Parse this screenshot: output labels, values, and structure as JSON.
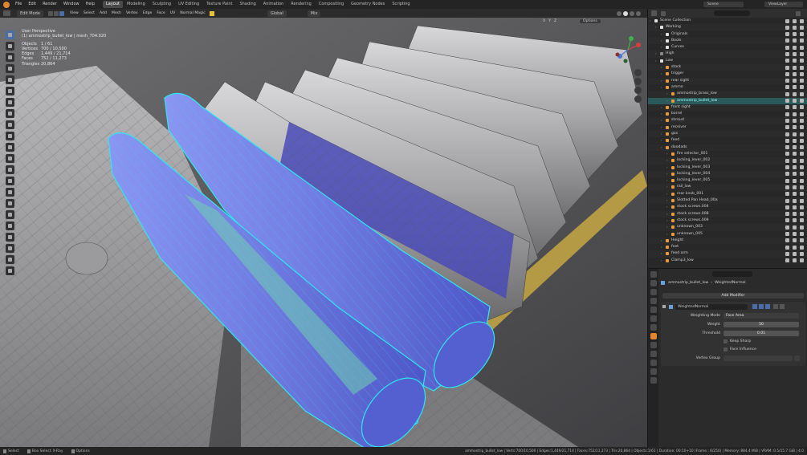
{
  "menu": {
    "items": [
      "File",
      "Edit",
      "Render",
      "Window",
      "Help"
    ],
    "workspaces": [
      "Layout",
      "Modeling",
      "Sculpting",
      "UV Editing",
      "Texture Paint",
      "Shading",
      "Animation",
      "Rendering",
      "Compositing",
      "Geometry Nodes",
      "Scripting"
    ],
    "active_workspace": "Layout",
    "scene": "Scene",
    "view_layer": "ViewLayer"
  },
  "viewport_header": {
    "mode": "Edit Mode",
    "menus": [
      "View",
      "Select",
      "Add",
      "Mesh",
      "Vertex",
      "Edge",
      "Face",
      "UV"
    ],
    "normal_magic": "Normal Magic",
    "orientation": "Global",
    "pivot": "Mix",
    "options": "Options",
    "axes": [
      "X",
      "Y",
      "Z"
    ]
  },
  "viewport_info": {
    "perspective": "User Perspective",
    "object_line": "(1) ammostrip_bullet_low | mesh_704.020",
    "stats": [
      {
        "label": "Objects",
        "value": "1 / 61"
      },
      {
        "label": "Vertices",
        "value": "700 / 10,500"
      },
      {
        "label": "Edges",
        "value": "1,449 / 21,714"
      },
      {
        "label": "Faces",
        "value": "752 / 11,273"
      },
      {
        "label": "Triangles",
        "value": "20,864"
      }
    ]
  },
  "outliner": {
    "title": "Scene Collection",
    "rows": [
      {
        "name": "Scene Collection",
        "indent": 0,
        "color": "#e0e0e0"
      },
      {
        "name": "Working",
        "indent": 1,
        "color": "#e0e0e0"
      },
      {
        "name": "Originals",
        "indent": 2,
        "color": "#e0e0e0"
      },
      {
        "name": "Bools",
        "indent": 2,
        "color": "#e0e0e0"
      },
      {
        "name": "Curves",
        "indent": 2,
        "color": "#e0e0e0"
      },
      {
        "name": "High",
        "indent": 1,
        "color": "#8a8a8a"
      },
      {
        "name": "Low",
        "indent": 1,
        "color": "#e0e0e0"
      },
      {
        "name": "stock",
        "indent": 2,
        "color": "#e89a3c"
      },
      {
        "name": "trigger",
        "indent": 2,
        "color": "#e89a3c"
      },
      {
        "name": "rear sight",
        "indent": 2,
        "color": "#e89a3c"
      },
      {
        "name": "ammo",
        "indent": 2,
        "color": "#e89a3c"
      },
      {
        "name": "ammostrip_brass_low",
        "indent": 3,
        "color": "#e89a3c"
      },
      {
        "name": "ammostrip_bullet_low",
        "indent": 3,
        "color": "#e89a3c",
        "selected": true
      },
      {
        "name": "front sight",
        "indent": 2,
        "color": "#e89a3c"
      },
      {
        "name": "barrel",
        "indent": 2,
        "color": "#e89a3c"
      },
      {
        "name": "shroud",
        "indent": 2,
        "color": "#e89a3c"
      },
      {
        "name": "receiver",
        "indent": 2,
        "color": "#e89a3c"
      },
      {
        "name": "gas",
        "indent": 2,
        "color": "#e89a3c"
      },
      {
        "name": "feed",
        "indent": 2,
        "color": "#e89a3c"
      },
      {
        "name": "doodads",
        "indent": 2,
        "color": "#e89a3c"
      },
      {
        "name": "fire selector_001",
        "indent": 3,
        "color": "#e89a3c"
      },
      {
        "name": "locking_lever_002",
        "indent": 3,
        "color": "#e89a3c"
      },
      {
        "name": "locking_lever_003",
        "indent": 3,
        "color": "#e89a3c"
      },
      {
        "name": "locking_lever_004",
        "indent": 3,
        "color": "#e89a3c"
      },
      {
        "name": "locking_lever_005",
        "indent": 3,
        "color": "#e89a3c"
      },
      {
        "name": "rail_low",
        "indent": 3,
        "color": "#e89a3c"
      },
      {
        "name": "rear knob_001",
        "indent": 3,
        "color": "#e89a3c"
      },
      {
        "name": "Slotted Pan Head_00a",
        "indent": 3,
        "color": "#e89a3c"
      },
      {
        "name": "stock screws.004",
        "indent": 3,
        "color": "#e89a3c"
      },
      {
        "name": "stock screws.008",
        "indent": 3,
        "color": "#e89a3c"
      },
      {
        "name": "stock screws.009",
        "indent": 3,
        "color": "#e89a3c"
      },
      {
        "name": "unknown_003",
        "indent": 3,
        "color": "#e89a3c"
      },
      {
        "name": "unknown_005",
        "indent": 3,
        "color": "#e89a3c"
      },
      {
        "name": "Height",
        "indent": 2,
        "color": "#e89a3c"
      },
      {
        "name": "feet",
        "indent": 2,
        "color": "#e89a3c"
      },
      {
        "name": "feed arm",
        "indent": 2,
        "color": "#e89a3c"
      },
      {
        "name": "Clamp3_low",
        "indent": 2,
        "color": "#e89a3c"
      }
    ]
  },
  "properties": {
    "object_name": "ammostrip_bullet_low",
    "modifier_crumb": "WeightedNormal",
    "add_modifier": "Add Modifier",
    "modifier": {
      "name": "WeightedNormal",
      "weighting_mode_label": "Weighting Mode",
      "weighting_mode_value": "Face Area",
      "weight_label": "Weight",
      "weight_value": "50",
      "threshold_label": "Threshold",
      "threshold_value": "0.01",
      "keep_sharp": "Keep Sharp",
      "face_influence": "Face Influence",
      "vertex_group_label": "Vertex Group"
    }
  },
  "statusbar": {
    "left": [
      "Select",
      "Box Select",
      "X-Ray",
      "Options"
    ],
    "right": "ammostrip_bullet_low | Verts:700/10,500 | Edges:1,449/21,714 | Faces:752/11,273 | Tris:20,864 | Objects:1/61 | Duration: 00:10+10 (Frame : 6/250) | Memory: 884.4 MiB | VRAM: 0.5/15.7 GiB | 4.0"
  }
}
